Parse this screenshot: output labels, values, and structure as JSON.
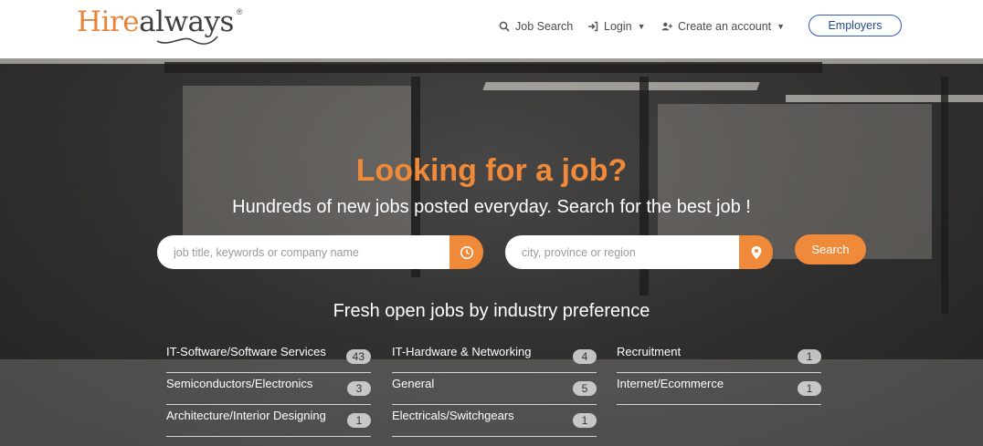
{
  "brand": {
    "logo_hi": "Hi",
    "logo_re": "re",
    "logo_rest": "always",
    "registered": "®",
    "accent": "#ef8a3a"
  },
  "nav": {
    "job_search": "Job Search",
    "login": "Login",
    "create_account": "Create an account",
    "employers": "Employers"
  },
  "icons": {
    "job_search": "search-icon",
    "login": "sign-in-icon",
    "create_account": "user-plus-icon",
    "keywords": "clock-icon",
    "location": "map-pin-icon"
  },
  "hero": {
    "headline": "Looking for a job?",
    "subline": "Hundreds of new jobs posted everyday. Search for the best job !"
  },
  "search": {
    "keywords_placeholder": "job title, keywords or company name",
    "location_placeholder": "city, province or region",
    "button": "Search"
  },
  "industries": {
    "title": "Fresh open jobs by industry preference",
    "items": [
      {
        "label": "IT-Software/Software Services",
        "count": "43"
      },
      {
        "label": "IT-Hardware & Networking",
        "count": "4"
      },
      {
        "label": "Recruitment",
        "count": "1"
      },
      {
        "label": "Semiconductors/Electronics",
        "count": "3"
      },
      {
        "label": "General",
        "count": "5"
      },
      {
        "label": "Internet/Ecommerce",
        "count": "1"
      },
      {
        "label": "Architecture/Interior Designing",
        "count": "1"
      },
      {
        "label": "Electricals/Switchgears",
        "count": "1"
      }
    ]
  }
}
